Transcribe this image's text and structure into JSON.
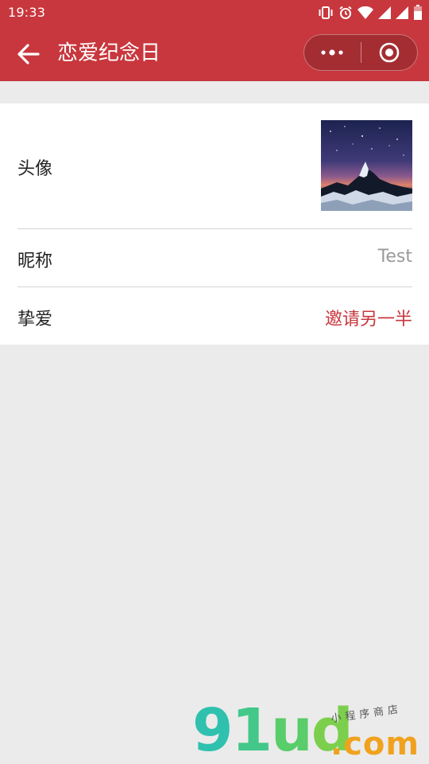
{
  "status_bar": {
    "time": "19:33",
    "icons": [
      "vibrate-icon",
      "alarm-icon",
      "wifi-icon",
      "signal-icon",
      "signal-icon",
      "battery-icon"
    ]
  },
  "nav": {
    "title": "恋爱纪念日",
    "back_icon": "back-arrow-icon",
    "more_icon": "more-dots-icon",
    "close_icon": "target-circle-icon"
  },
  "profile": {
    "avatar_label": "头像",
    "avatar_image": "mountain-starry-night",
    "nickname_label": "昵称",
    "nickname_value": "Test",
    "partner_label": "挚爱",
    "partner_action": "邀请另一半"
  },
  "colors": {
    "header": "#c8373d",
    "accent": "#c8373d",
    "background": "#ebebeb"
  },
  "watermark": {
    "brand": "91ud",
    "domain": ".com",
    "tagline": "小程序商店"
  }
}
